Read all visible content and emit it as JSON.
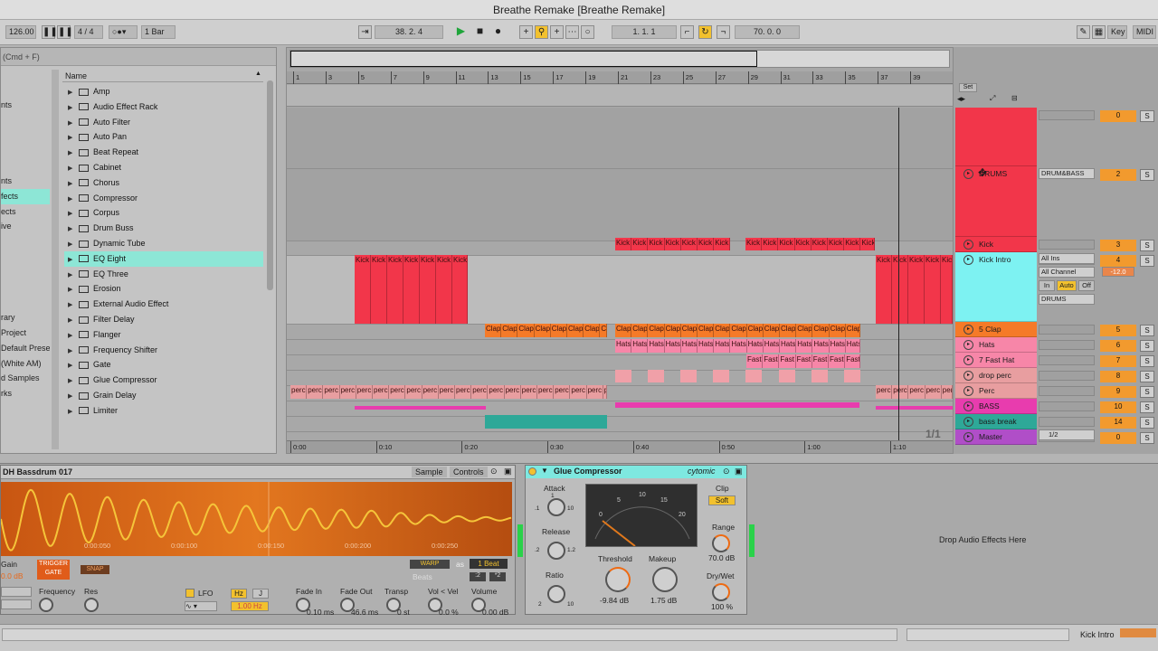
{
  "window": {
    "title": "Breathe Remake  [Breathe Remake]"
  },
  "control_bar": {
    "tempo": "126.00",
    "signature": "4 / 4",
    "quantize": "1 Bar",
    "arrangement_position": "38.  2.  4",
    "loop_start": "1.  1.  1",
    "loop_length": "70.  0.  0",
    "key_label": "Key",
    "midi_label": "MIDI"
  },
  "browser": {
    "search_hint": "(Cmd + F)",
    "column_header": "Name",
    "categories": [
      "nts",
      "",
      "",
      "",
      "",
      "nts",
      "fects",
      "ects",
      "ive",
      "",
      "",
      "",
      "",
      "",
      "rary",
      "Project",
      "Default Prese",
      "(White AM)",
      "d Samples",
      "rks"
    ],
    "items": [
      "Amp",
      "Audio Effect Rack",
      "Auto Filter",
      "Auto Pan",
      "Beat Repeat",
      "Cabinet",
      "Chorus",
      "Compressor",
      "Corpus",
      "Drum Buss",
      "Dynamic Tube",
      "EQ Eight",
      "EQ Three",
      "Erosion",
      "External Audio Effect",
      "Filter Delay",
      "Flanger",
      "Frequency Shifter",
      "Gate",
      "Glue Compressor",
      "Grain Delay",
      "Limiter"
    ],
    "selected_item": "EQ Eight"
  },
  "arrangement": {
    "bar_numbers": [
      "1",
      "3",
      "5",
      "7",
      "9",
      "11",
      "13",
      "15",
      "17",
      "19",
      "21",
      "23",
      "25",
      "27",
      "29",
      "31",
      "33",
      "35",
      "37",
      "39"
    ],
    "time_labels": [
      "0:00",
      "0:10",
      "0:20",
      "0:30",
      "0:40",
      "0:50",
      "1:00",
      "1:10"
    ],
    "page_indicator": "1/1",
    "set_label": "Set",
    "clips": {
      "kick": "Kick",
      "clap": "Clap",
      "hats": "Hats",
      "fast": "Fast",
      "perc": "perc"
    }
  },
  "tracks": [
    {
      "name": "",
      "color": "#f2364a",
      "number": "0",
      "input": ""
    },
    {
      "name": "DRUMS",
      "color": "#f2364a",
      "number": "2",
      "input": "DRUM&BASS"
    },
    {
      "name": "Kick",
      "color": "#f2364a",
      "number": "3",
      "input": ""
    },
    {
      "name": "Kick Intro",
      "color": "#7df2f2",
      "number": "4",
      "input": "All Ins",
      "channel": "All Channel",
      "monitor": [
        "In",
        "Auto",
        "Off"
      ],
      "output": "DRUMS",
      "volume": "-12.0"
    },
    {
      "name": "5 Clap",
      "color": "#f57a28",
      "number": "5"
    },
    {
      "name": "Hats",
      "color": "#f786a8",
      "number": "6"
    },
    {
      "name": "7 Fast Hat",
      "color": "#f786a8",
      "number": "7"
    },
    {
      "name": "drop perc",
      "color": "#e89ea0",
      "number": "8"
    },
    {
      "name": "Perc",
      "color": "#e89ea0",
      "number": "9"
    },
    {
      "name": "BASS",
      "color": "#e83cae",
      "number": "10"
    },
    {
      "name": "bass break",
      "color": "#2ea898",
      "number": "14"
    },
    {
      "name": "Master",
      "color": "#b04ec8",
      "number": "0",
      "output": "1/2"
    }
  ],
  "simpler": {
    "sample_name": "DH Bassdrum 017",
    "tab_sample": "Sample",
    "tab_controls": "Controls",
    "times": [
      "0:00:050",
      "0:00:100",
      "0:00:150",
      "0:00:200",
      "0:00:250"
    ],
    "trigger": "TRIGGER",
    "gate": "GATE",
    "snap": "SNAP",
    "warp": "WARP",
    "as": "as",
    "beat": "1 Beat",
    "beats": "Beats",
    "div": ":2",
    "mul": "*2",
    "gain_label": "Gain",
    "gain_value": "0.0 dB",
    "frequency_label": "Frequency",
    "res_label": "Res",
    "lfo": "LFO",
    "hz": "Hz",
    "j": "J",
    "lfo_rate": "1.00 Hz",
    "fade_in_label": "Fade In",
    "fade_in": "0.10 ms",
    "fade_out_label": "Fade Out",
    "fade_out": "46.6 ms",
    "transp_label": "Transp",
    "transp": "0 st",
    "vol_vel_label": "Vol < Vel",
    "vol_vel": "0.0 %",
    "volume_label": "Volume",
    "volume": "0.00 dB"
  },
  "glue": {
    "title": "Glue Compressor",
    "brand": "cytomic",
    "attack": "Attack",
    "attack_marks": [
      ".1",
      ".3",
      "1",
      "3",
      "10",
      "30",
      ".01"
    ],
    "release": "Release",
    "release_marks": [
      ".2",
      ".4",
      ".6",
      "1.2",
      ".1",
      "A"
    ],
    "ratio": "Ratio",
    "ratio_marks": [
      "2",
      "4",
      "10"
    ],
    "meter_marks": [
      "0",
      "5",
      "10",
      "15",
      "20"
    ],
    "threshold_label": "Threshold",
    "threshold": "-9.84 dB",
    "makeup_label": "Makeup",
    "makeup": "1.75 dB",
    "clip_label": "Clip",
    "soft": "Soft",
    "range_label": "Range",
    "range": "70.0 dB",
    "drywet_label": "Dry/Wet",
    "drywet": "100 %"
  },
  "drop_zone": "Drop Audio Effects Here",
  "status": {
    "track_name": "Kick Intro"
  }
}
